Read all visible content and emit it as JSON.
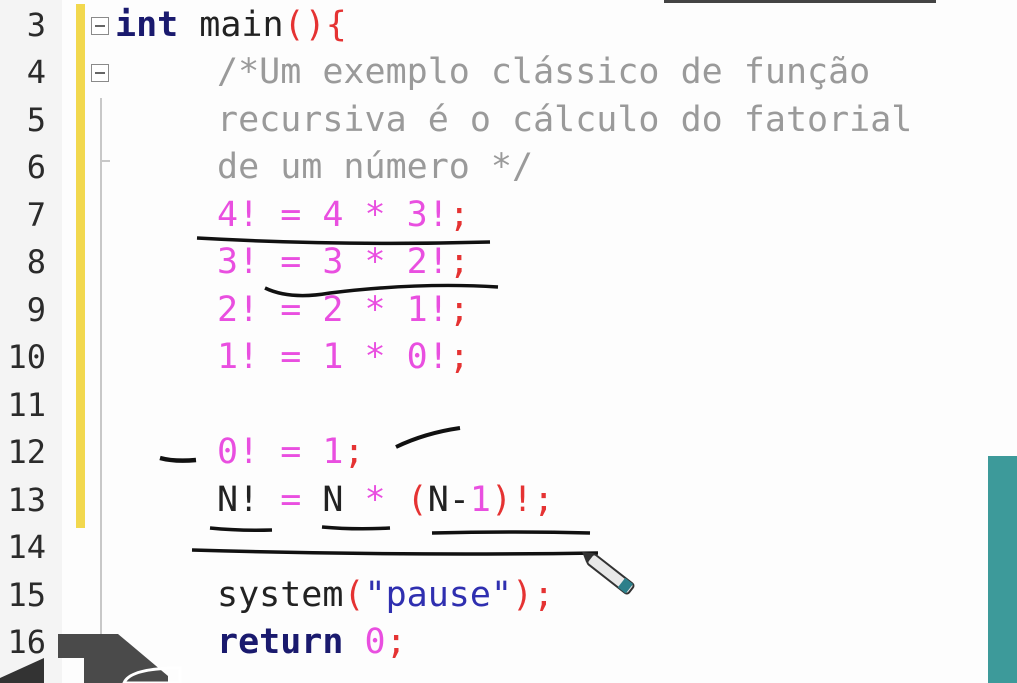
{
  "editor": {
    "line_numbers": [
      "3",
      "4",
      "5",
      "6",
      "7",
      "8",
      "9",
      "10",
      "11",
      "12",
      "13",
      "14",
      "15",
      "16"
    ],
    "lines": {
      "l3": {
        "kw": "int",
        "fn": " main",
        "p1": "()",
        "p2": "{"
      },
      "l4": {
        "comment": "/*Um exemplo clássico de função"
      },
      "l5": {
        "comment": "recursiva é o cálculo do fatorial"
      },
      "l6": {
        "comment": "de um número */"
      },
      "l7": {
        "a": "4! = 4 * 3!",
        "semi": ";"
      },
      "l8": {
        "a": "3! = 3 * 2!",
        "semi": ";"
      },
      "l9": {
        "a": "2! = 2 * 1!",
        "semi": ";"
      },
      "l10": {
        "a": "1! = 1 * 0!",
        "semi": ";"
      },
      "l12": {
        "a": "0! = 1",
        "semi": ";"
      },
      "l13": {
        "n1": "N!",
        "eq": " = ",
        "n2": "N",
        "star": " * ",
        "open": "(",
        "n3": "N-",
        "one": "1",
        "close": ")!;"
      },
      "l15": {
        "fn": "system",
        "open": "(",
        "str": "\"pause\"",
        "close": ");"
      },
      "l16": {
        "kw": "return",
        "num": " 0",
        "semi": ";"
      }
    }
  },
  "colors": {
    "keyword": "#1a1a6e",
    "punctuation": "#e53333",
    "comment": "#9a9a9a",
    "magenta": "#e94fe0",
    "string": "#2f2fb0",
    "change_bar": "#f2d84e",
    "teal": "#3d9a9a"
  },
  "icons": [
    "fold-minus-icon",
    "pen-cursor-icon"
  ]
}
